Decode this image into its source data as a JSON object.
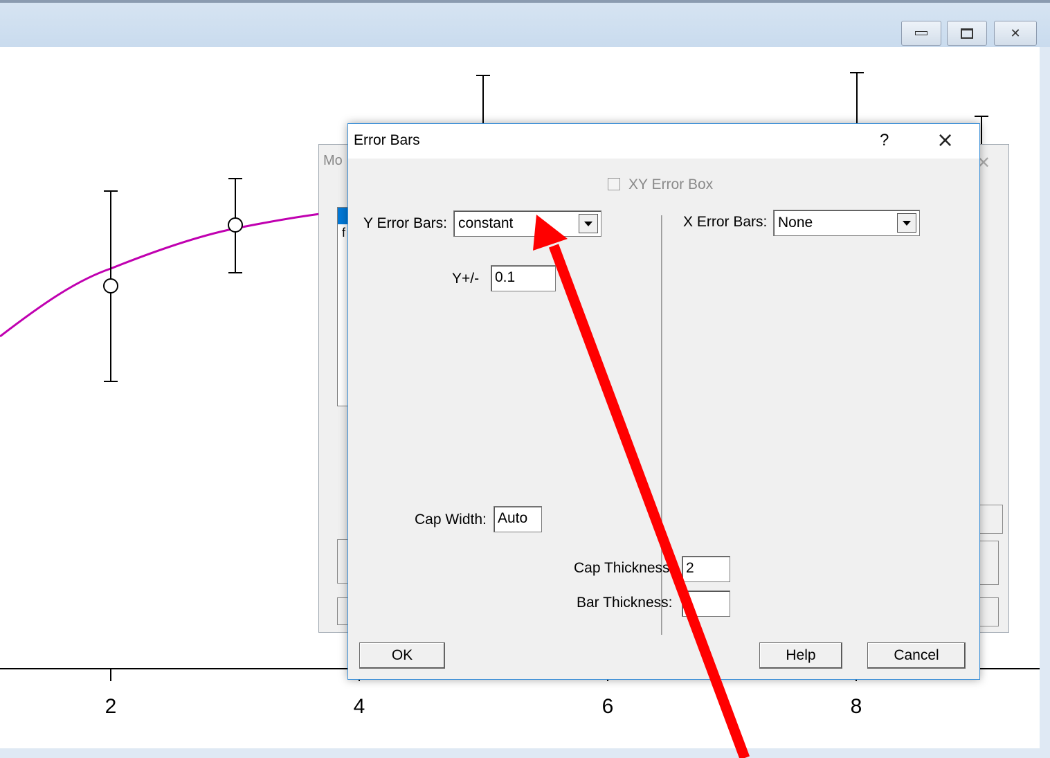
{
  "plot": {
    "x_tick_labels": [
      "2",
      "4",
      "6",
      "8"
    ]
  },
  "bg_dialog": {
    "title_fragment": "Mo",
    "list_fragment": "f"
  },
  "dialog": {
    "title": "Error Bars",
    "help_symbol": "?",
    "close_symbol": "×",
    "xy_error_box_label": "XY Error Box",
    "y_error_bars_label": "Y Error Bars:",
    "y_error_bars_value": "constant",
    "x_error_bars_label": "X Error Bars:",
    "x_error_bars_value": "None",
    "y_plusminus_label": "Y+/-",
    "y_plusminus_value": "0.1",
    "cap_width_label": "Cap Width:",
    "cap_width_value": "Auto",
    "cap_thickness_label": "Cap Thickness:",
    "cap_thickness_value": "2",
    "bar_thickness_label": "Bar Thickness:",
    "bar_thickness_value": "",
    "ok_label": "OK",
    "help_label": "Help",
    "cancel_label": "Cancel"
  },
  "colors": {
    "curve": "#c000b0",
    "annotation_arrow": "#ff0000",
    "dialog_border": "#3a8fd8"
  }
}
